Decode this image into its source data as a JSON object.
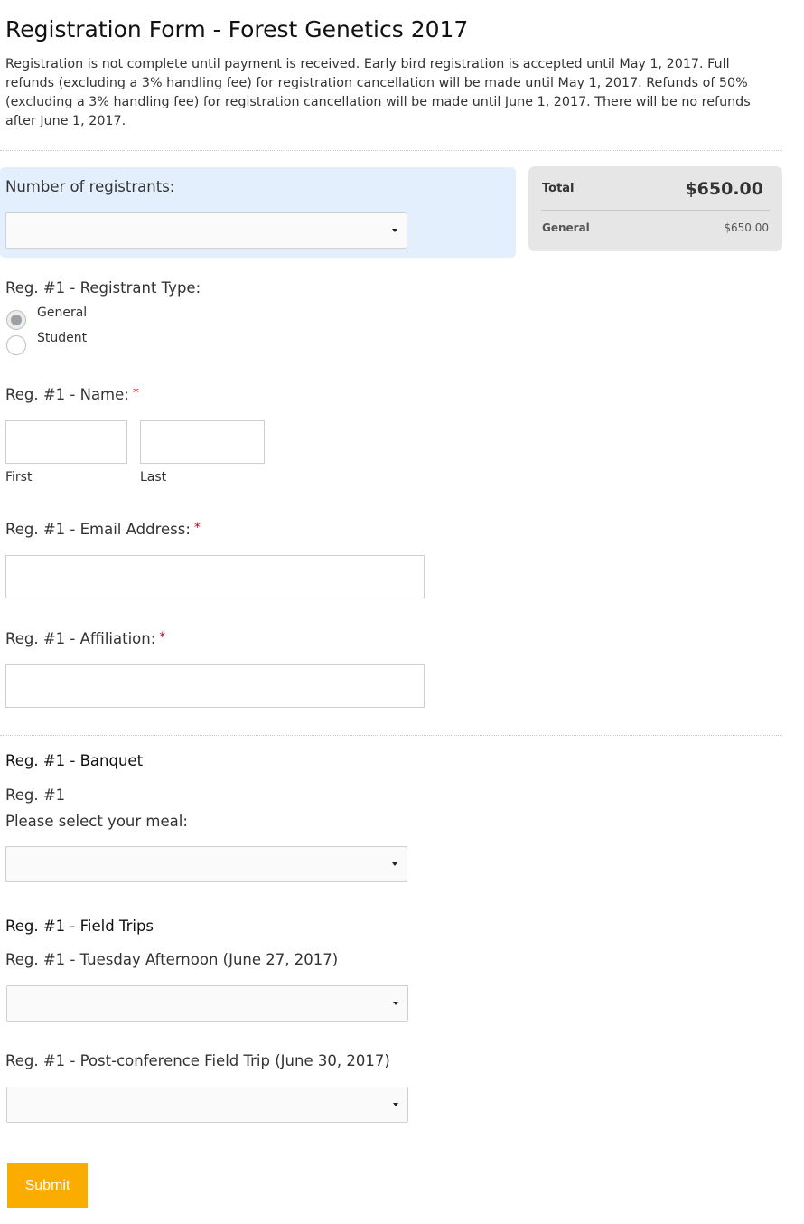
{
  "header": {
    "title": "Registration Form - Forest Genetics 2017",
    "intro": "Registration is not complete until payment is received. Early bird registration is accepted until May 1, 2017. Full refunds (excluding a 3% handling fee) for registration cancellation will be made until May 1, 2017. Refunds of 50% (excluding a 3% handling fee) for registration cancellation will be made until June 1, 2017. There will be no refunds after June 1, 2017."
  },
  "registrants": {
    "label": "Number of registrants:",
    "selected": ""
  },
  "summary": {
    "total_label": "Total",
    "total_value": "$650.00",
    "line_label": "General",
    "line_value": "$650.00"
  },
  "registrant_type": {
    "label": "Reg. #1 - Registrant Type:",
    "options": [
      {
        "label": "General",
        "checked": true
      },
      {
        "label": "Student",
        "checked": false
      }
    ]
  },
  "name": {
    "label": "Reg. #1 - Name:",
    "required_mark": "*",
    "first_label": "First",
    "last_label": "Last",
    "first_value": "",
    "last_value": ""
  },
  "email": {
    "label": "Reg. #1 - Email Address:",
    "required_mark": "*",
    "value": ""
  },
  "affiliation": {
    "label": "Reg. #1 - Affiliation:",
    "required_mark": "*",
    "value": ""
  },
  "banquet": {
    "heading": "Reg. #1 - Banquet",
    "reg_line": "Reg. #1",
    "meal_label": "Please select your meal:",
    "selected": ""
  },
  "field_trips": {
    "heading": "Reg. #1 - Field Trips",
    "tuesday_label": "Reg. #1 - Tuesday Afternoon (June 27, 2017)",
    "tuesday_selected": "",
    "post_label": "Reg. #1 - Post-conference Field Trip (June 30, 2017)",
    "post_selected": ""
  },
  "actions": {
    "submit_label": "Submit"
  },
  "colors": {
    "accent": "#fbac00",
    "required": "#d0021b",
    "panel_blue": "#e3effc",
    "summary_gray": "#e6e6e6"
  }
}
